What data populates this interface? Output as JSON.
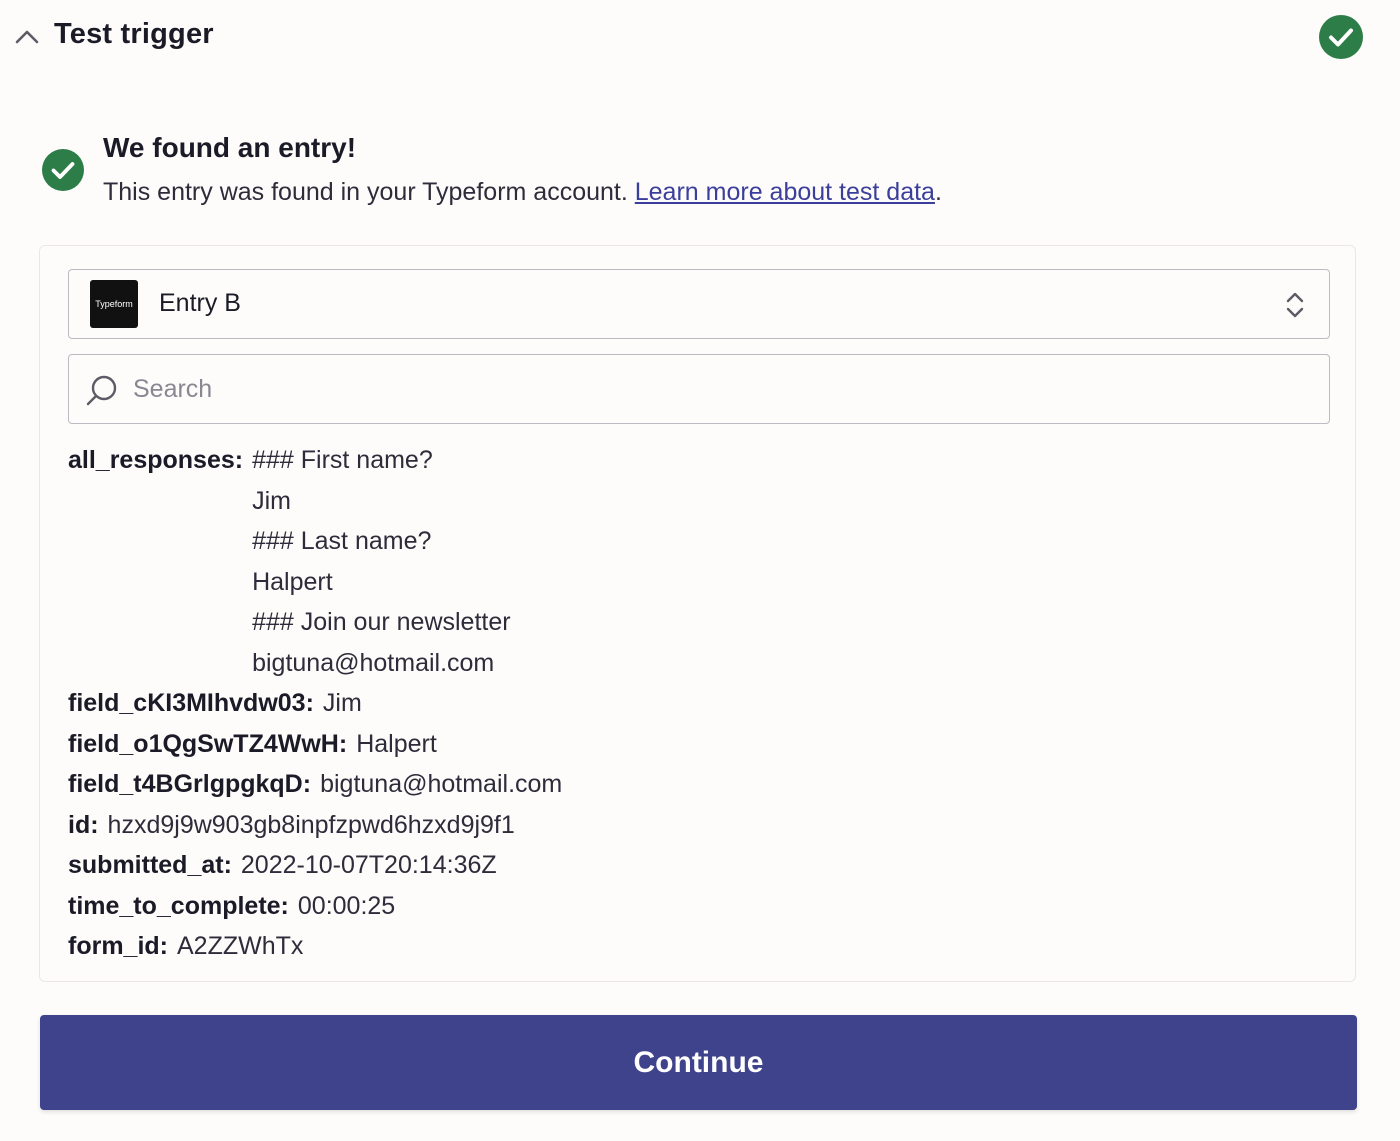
{
  "header": {
    "title": "Test trigger",
    "collapse_icon": "chevron-up-icon",
    "status_icon": "check-circle-icon",
    "success_color": "#2d7d48"
  },
  "result": {
    "title": "We found an entry!",
    "description": "This entry was found in your Typeform account. ",
    "link_text": "Learn more about test data",
    "suffix": "."
  },
  "entry_select": {
    "logo_text": "Typeform",
    "selected": "Entry B"
  },
  "search": {
    "placeholder": "Search"
  },
  "fields": [
    {
      "key": "all_responses:",
      "values": [
        "### First name?",
        "Jim",
        "### Last name?",
        "Halpert",
        "### Join our newsletter",
        "bigtuna@hotmail.com"
      ]
    },
    {
      "key": "field_cKI3MIhvdw03:",
      "values": [
        "Jim"
      ]
    },
    {
      "key": "field_o1QgSwTZ4WwH:",
      "values": [
        "Halpert"
      ]
    },
    {
      "key": "field_t4BGrlgpgkqD:",
      "values": [
        "bigtuna@hotmail.com"
      ]
    },
    {
      "key": "id:",
      "values": [
        "hzxd9j9w903gb8inpfzpwd6hzxd9j9f1"
      ]
    },
    {
      "key": "submitted_at:",
      "values": [
        "2022-10-07T20:14:36Z"
      ]
    },
    {
      "key": "time_to_complete:",
      "values": [
        "00:00:25"
      ]
    },
    {
      "key": "form_id:",
      "values": [
        "A2ZZWhTx"
      ]
    }
  ],
  "actions": {
    "continue_label": "Continue",
    "primary_color": "#3e438c"
  }
}
